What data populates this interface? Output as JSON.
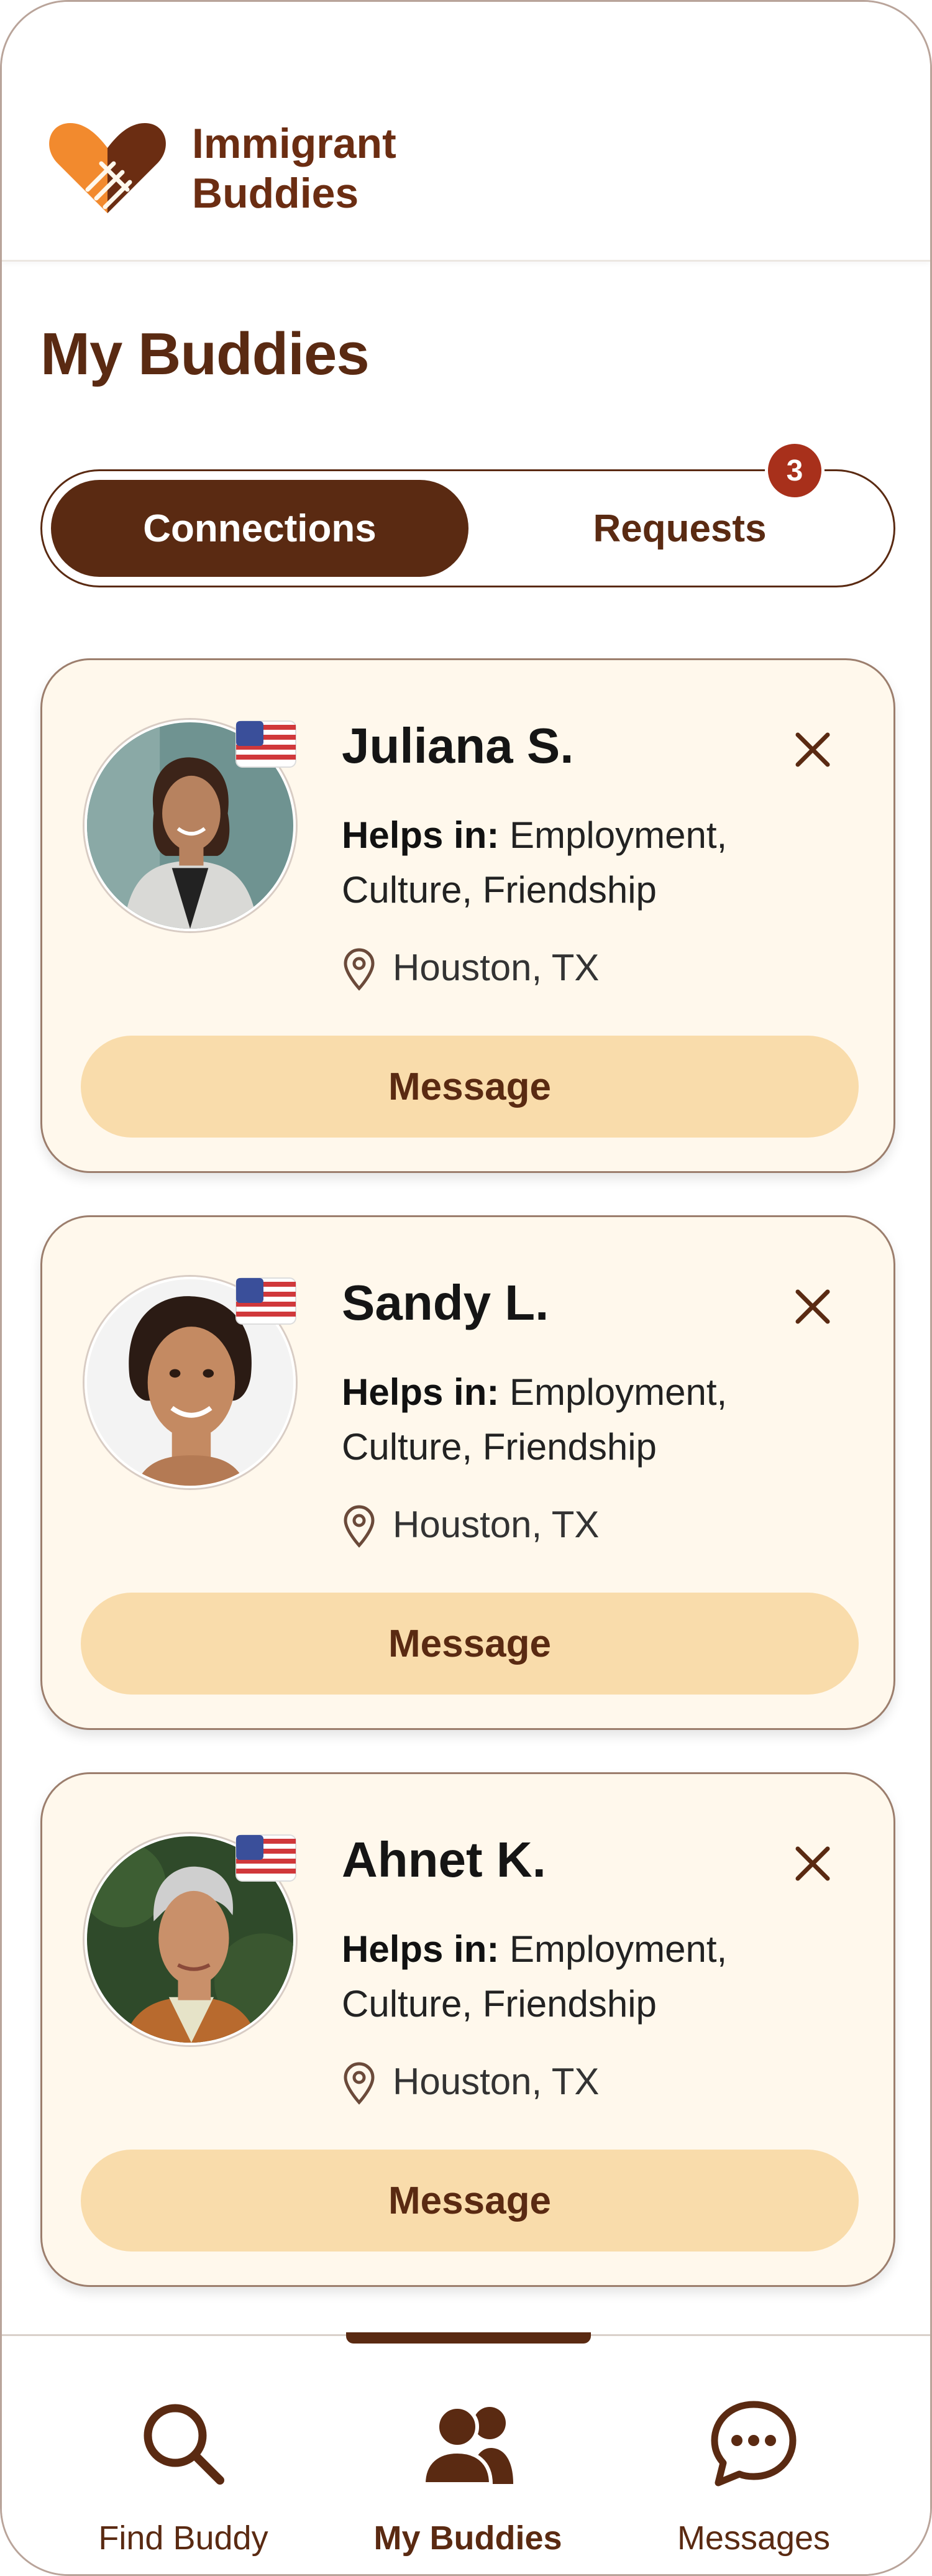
{
  "app": {
    "name_line1": "Immigrant",
    "name_line2": "Buddies",
    "brand_color": "#5a2a12",
    "accent_color": "#f28a2e"
  },
  "page": {
    "title": "My Buddies"
  },
  "tabs": {
    "connections": "Connections",
    "requests": "Requests",
    "requests_count": "3",
    "active": "Connections"
  },
  "buddies": [
    {
      "name": "Juliana S.",
      "helps_label": "Helps in:",
      "helps_value": "Employment, Culture, Friendship",
      "location": "Houston, TX",
      "button": "Message",
      "flag_icon": "us-flag-icon"
    },
    {
      "name": "Sandy L.",
      "helps_label": "Helps in:",
      "helps_value": "Employment, Culture, Friendship",
      "location": "Houston, TX",
      "button": "Message",
      "flag_icon": "us-flag-icon"
    },
    {
      "name": "Ahnet K.",
      "helps_label": "Helps in:",
      "helps_value": "Employment, Culture, Friendship",
      "location": "Houston, TX",
      "button": "Message",
      "flag_icon": "us-flag-icon"
    }
  ],
  "nav": {
    "items": [
      {
        "label": "Find Buddy",
        "icon": "search-icon"
      },
      {
        "label": "My Buddies",
        "icon": "people-icon"
      },
      {
        "label": "Messages",
        "icon": "chat-icon"
      }
    ],
    "active": "My Buddies"
  }
}
